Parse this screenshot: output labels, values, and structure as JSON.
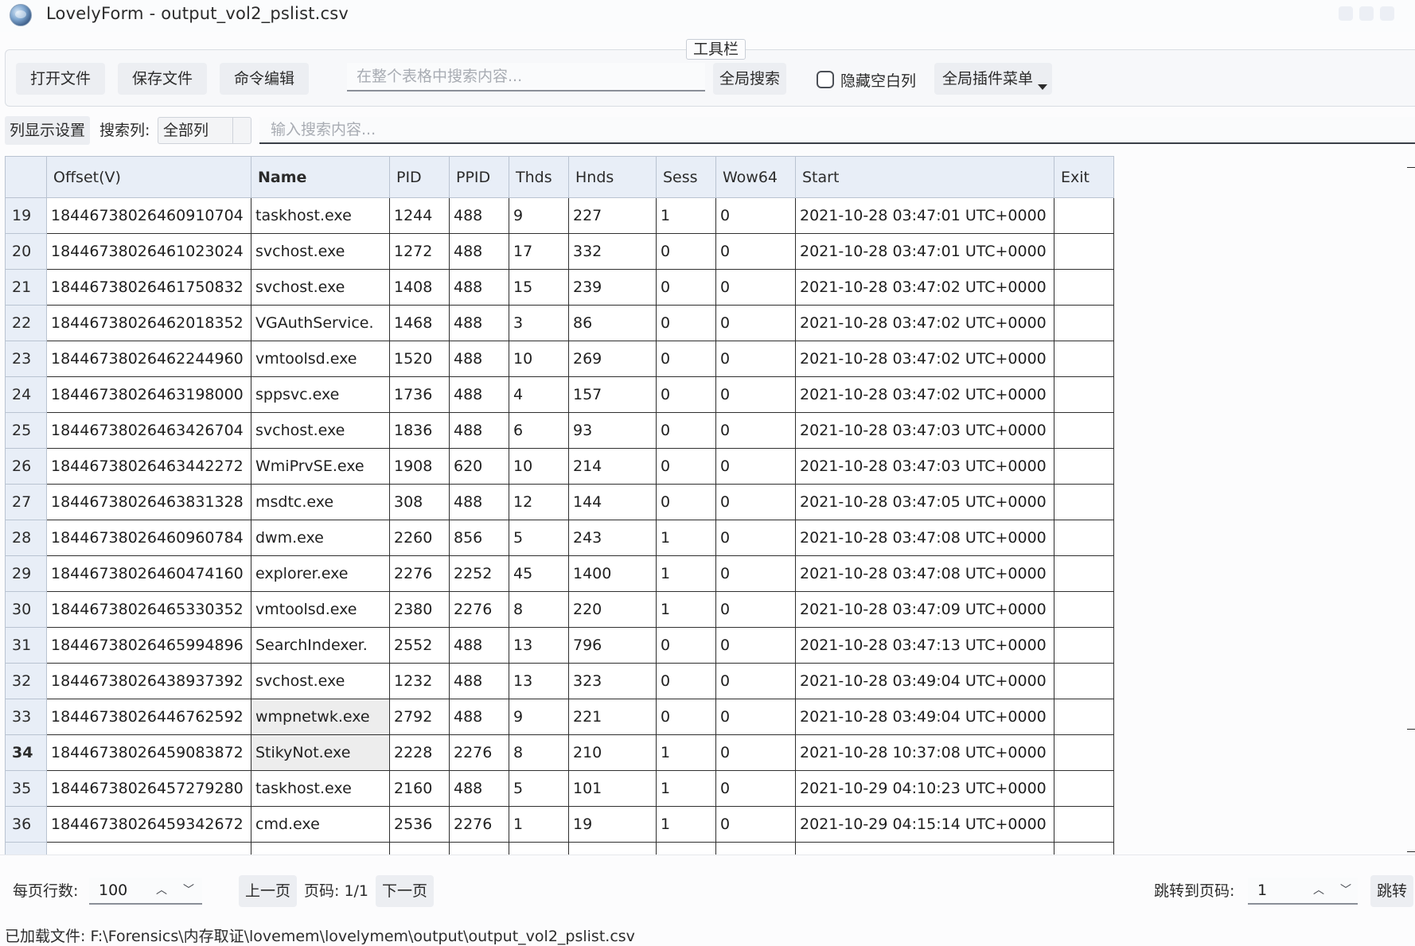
{
  "window": {
    "title": "LovelyForm - output_vol2_pslist.csv"
  },
  "toolbar": {
    "caption": "工具栏",
    "open_file": "打开文件",
    "save_file": "保存文件",
    "cmd_edit": "命令编辑",
    "global_search_placeholder": "在整个表格中搜索内容...",
    "global_search_value": "",
    "global_search_button": "全局搜索",
    "hide_empty_cols_label": "隐藏空白列",
    "hide_empty_cols_checked": false,
    "plugin_menu": "全局插件菜单"
  },
  "filter": {
    "column_settings": "列显示设置",
    "search_col_label": "搜索列:",
    "search_col_selected": "全部列",
    "search_placeholder": "输入搜索内容...",
    "search_value": ""
  },
  "table": {
    "columns": [
      "Offset(V)",
      "Name",
      "PID",
      "PPID",
      "Thds",
      "Hnds",
      "Sess",
      "Wow64",
      "Start",
      "Exit"
    ],
    "rows": [
      {
        "num": "19",
        "cells": [
          "18446738026460910704",
          "taskhost.exe",
          "1244",
          "488",
          "9",
          "227",
          "1",
          "0",
          "2021-10-28 03:47:01 UTC+0000",
          ""
        ]
      },
      {
        "num": "20",
        "cells": [
          "18446738026461023024",
          "svchost.exe",
          "1272",
          "488",
          "17",
          "332",
          "0",
          "0",
          "2021-10-28 03:47:01 UTC+0000",
          ""
        ]
      },
      {
        "num": "21",
        "cells": [
          "18446738026461750832",
          "svchost.exe",
          "1408",
          "488",
          "15",
          "239",
          "0",
          "0",
          "2021-10-28 03:47:02 UTC+0000",
          ""
        ]
      },
      {
        "num": "22",
        "cells": [
          "18446738026462018352",
          "VGAuthService.",
          "1468",
          "488",
          "3",
          "86",
          "0",
          "0",
          "2021-10-28 03:47:02 UTC+0000",
          ""
        ]
      },
      {
        "num": "23",
        "cells": [
          "18446738026462244960",
          "vmtoolsd.exe",
          "1520",
          "488",
          "10",
          "269",
          "0",
          "0",
          "2021-10-28 03:47:02 UTC+0000",
          ""
        ]
      },
      {
        "num": "24",
        "cells": [
          "18446738026463198000",
          "sppsvc.exe",
          "1736",
          "488",
          "4",
          "157",
          "0",
          "0",
          "2021-10-28 03:47:02 UTC+0000",
          ""
        ]
      },
      {
        "num": "25",
        "cells": [
          "18446738026463426704",
          "svchost.exe",
          "1836",
          "488",
          "6",
          "93",
          "0",
          "0",
          "2021-10-28 03:47:03 UTC+0000",
          ""
        ]
      },
      {
        "num": "26",
        "cells": [
          "18446738026463442272",
          "WmiPrvSE.exe",
          "1908",
          "620",
          "10",
          "214",
          "0",
          "0",
          "2021-10-28 03:47:03 UTC+0000",
          ""
        ]
      },
      {
        "num": "27",
        "cells": [
          "18446738026463831328",
          "msdtc.exe",
          "308",
          "488",
          "12",
          "144",
          "0",
          "0",
          "2021-10-28 03:47:05 UTC+0000",
          ""
        ]
      },
      {
        "num": "28",
        "cells": [
          "18446738026460960784",
          "dwm.exe",
          "2260",
          "856",
          "5",
          "243",
          "1",
          "0",
          "2021-10-28 03:47:08 UTC+0000",
          ""
        ]
      },
      {
        "num": "29",
        "cells": [
          "18446738026460474160",
          "explorer.exe",
          "2276",
          "2252",
          "45",
          "1400",
          "1",
          "0",
          "2021-10-28 03:47:08 UTC+0000",
          ""
        ]
      },
      {
        "num": "30",
        "cells": [
          "18446738026465330352",
          "vmtoolsd.exe",
          "2380",
          "2276",
          "8",
          "220",
          "1",
          "0",
          "2021-10-28 03:47:09 UTC+0000",
          ""
        ]
      },
      {
        "num": "31",
        "cells": [
          "18446738026465994896",
          "SearchIndexer.",
          "2552",
          "488",
          "13",
          "796",
          "0",
          "0",
          "2021-10-28 03:47:13 UTC+0000",
          ""
        ]
      },
      {
        "num": "32",
        "cells": [
          "18446738026438937392",
          "svchost.exe",
          "1232",
          "488",
          "13",
          "323",
          "0",
          "0",
          "2021-10-28 03:49:04 UTC+0000",
          ""
        ]
      },
      {
        "num": "33",
        "cells": [
          "18446738026446762592",
          "wmpnetwk.exe",
          "2792",
          "488",
          "9",
          "221",
          "0",
          "0",
          "2021-10-28 03:49:04 UTC+0000",
          ""
        ]
      },
      {
        "num": "34",
        "cells": [
          "18446738026459083872",
          "StikyNot.exe",
          "2228",
          "2276",
          "8",
          "210",
          "1",
          "0",
          "2021-10-28 10:37:08 UTC+0000",
          ""
        ]
      },
      {
        "num": "35",
        "cells": [
          "18446738026457279280",
          "taskhost.exe",
          "2160",
          "488",
          "5",
          "101",
          "1",
          "0",
          "2021-10-29 04:10:23 UTC+0000",
          ""
        ]
      },
      {
        "num": "36",
        "cells": [
          "18446738026459342672",
          "cmd.exe",
          "2536",
          "2276",
          "1",
          "19",
          "1",
          "0",
          "2021-10-29 04:15:14 UTC+0000",
          ""
        ]
      }
    ],
    "current_row": "34"
  },
  "paging": {
    "rows_per_page_label": "每页行数:",
    "rows_per_page_value": "100",
    "prev_page": "上一页",
    "page_info": "页码: 1/1",
    "next_page": "下一页",
    "jump_label": "跳转到页码:",
    "jump_value": "1",
    "jump_button": "跳转"
  },
  "status": {
    "loaded_file": "已加载文件: F:\\Forensics\\内存取证\\lovemem\\lovelymem\\output\\output_vol2_pslist.csv"
  },
  "icons": {
    "app": "globe-app-icon",
    "spin_up": "chevron-up-icon",
    "spin_down": "chevron-down-icon",
    "dropdown": "caret-down-icon"
  }
}
